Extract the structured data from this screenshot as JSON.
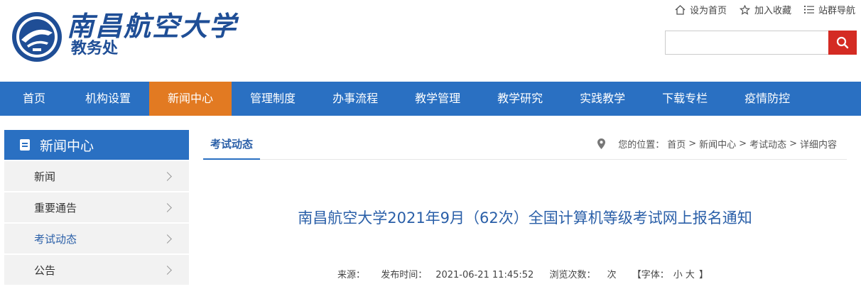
{
  "header": {
    "school_name": "南昌航空大学",
    "dept_name": "教务处",
    "toplinks": {
      "home": "设为首页",
      "favorite": "加入收藏",
      "sitemap": "站群导航"
    },
    "search": {
      "value": "",
      "placeholder": ""
    }
  },
  "nav": {
    "items": [
      {
        "label": "首页"
      },
      {
        "label": "机构设置"
      },
      {
        "label": "新闻中心",
        "active": true
      },
      {
        "label": "管理制度"
      },
      {
        "label": "办事流程"
      },
      {
        "label": "教学管理"
      },
      {
        "label": "教学研究"
      },
      {
        "label": "实践教学"
      },
      {
        "label": "下载专栏"
      },
      {
        "label": "疫情防控"
      }
    ]
  },
  "sidebar": {
    "title": "新闻中心",
    "items": [
      {
        "label": "新闻"
      },
      {
        "label": "重要通告"
      },
      {
        "label": "考试动态",
        "active": true
      },
      {
        "label": "公告"
      }
    ]
  },
  "content": {
    "tab": "考试动态",
    "breadcrumb": {
      "prefix": "您的位置：",
      "home": "首页",
      "sep1": ">",
      "news": "新闻中心",
      "sep2": ">",
      "exam": "考试动态",
      "sep3": ">",
      "detail": "详细内容"
    },
    "title": "南昌航空大学2021年9月（62次）全国计算机等级考试网上报名通知",
    "meta": {
      "source_label": "来源：",
      "publish_label": "发布时间：",
      "publish_time": "2021-06-21 11:45:52",
      "views_label": "浏览次数：",
      "views_suffix": "次",
      "font_open": "【字体：",
      "font_small": "小",
      "font_large": "大",
      "font_close": "】"
    }
  },
  "colors": {
    "nav_bg": "#2a70c2",
    "nav_active": "#e27a22",
    "search_btn": "#d42b23",
    "title_blue": "#2a5fa8"
  }
}
